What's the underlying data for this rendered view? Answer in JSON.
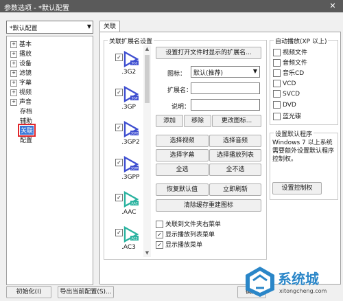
{
  "window": {
    "title": "参数选项 - *默认配置",
    "close": "✕"
  },
  "profile": {
    "value": "*默认配置"
  },
  "tree": {
    "groups": [
      "基本",
      "播放",
      "设备",
      "滤镜",
      "字幕",
      "视频",
      "声音"
    ],
    "leaves": [
      "存档",
      "辅助",
      "关联",
      "配置"
    ]
  },
  "tab": {
    "label": "关联"
  },
  "assoc": {
    "group_label": "关联扩展名设置",
    "extensions": [
      {
        "name": ".3G2",
        "badge": "3G2",
        "checked": "✓",
        "color": "#3f4fd0"
      },
      {
        "name": ".3GP",
        "badge": "3GP",
        "checked": "✓",
        "color": "#3f4fd0"
      },
      {
        "name": ".3GP2",
        "badge": "3GP2",
        "checked": "✓",
        "color": "#3f4fd0"
      },
      {
        "name": ".3GPP",
        "badge": "3GPP",
        "checked": "✓",
        "color": "#3f4fd0"
      },
      {
        "name": ".AAC",
        "badge": "AAC",
        "checked": "✓",
        "color": "#2bb3a0"
      },
      {
        "name": ".AC3",
        "badge": "AC3",
        "checked": "✓",
        "color": "#2bb3a0"
      }
    ],
    "set_open_ext_btn": "设置打开文件时显示的扩展名...",
    "icon_label": "图标：",
    "icon_value": "默认(推荐)",
    "ext_label": "扩展名：",
    "ext_value": "",
    "desc_label": "说明：",
    "desc_value": "",
    "add_btn": "添加",
    "remove_btn": "移除",
    "change_icon_btn": "更改图标...",
    "select_video": "选择视频",
    "select_audio": "选择音频",
    "select_subtitle": "选择字幕",
    "select_playlist": "选择播放列表",
    "select_all": "全选",
    "select_none": "全不选",
    "restore_default": "恢复默认值",
    "refresh_now": "立即刷新",
    "clear_cache": "清除缓存重建图标",
    "opt_folder_menu": {
      "label": "关联到文件夹右菜单",
      "checked": ""
    },
    "opt_playlist_menu": {
      "label": "显示播放列表菜单",
      "checked": "✓"
    },
    "opt_play_menu": {
      "label": "显示播放菜单",
      "checked": "✓"
    }
  },
  "autoplay": {
    "label": "自动播放(XP 以上)",
    "items": [
      {
        "label": "视频文件",
        "checked": ""
      },
      {
        "label": "音频文件",
        "checked": ""
      },
      {
        "label": "音乐CD",
        "checked": ""
      },
      {
        "label": "VCD",
        "checked": ""
      },
      {
        "label": "SVCD",
        "checked": ""
      },
      {
        "label": "DVD",
        "checked": ""
      },
      {
        "label": "蓝光碟",
        "checked": ""
      }
    ]
  },
  "default_prog": {
    "label": "设置默认程序",
    "text": "Windows 7 以上系统需要额外设置默认程序控制权。",
    "button": "设置控制权"
  },
  "bottom": {
    "init_btn": "初始化(I)",
    "export_btn": "导出当前配置(S)...",
    "ok_btn": "确定"
  },
  "watermark": {
    "text": "系统城",
    "url": "xitongcheng.com"
  }
}
